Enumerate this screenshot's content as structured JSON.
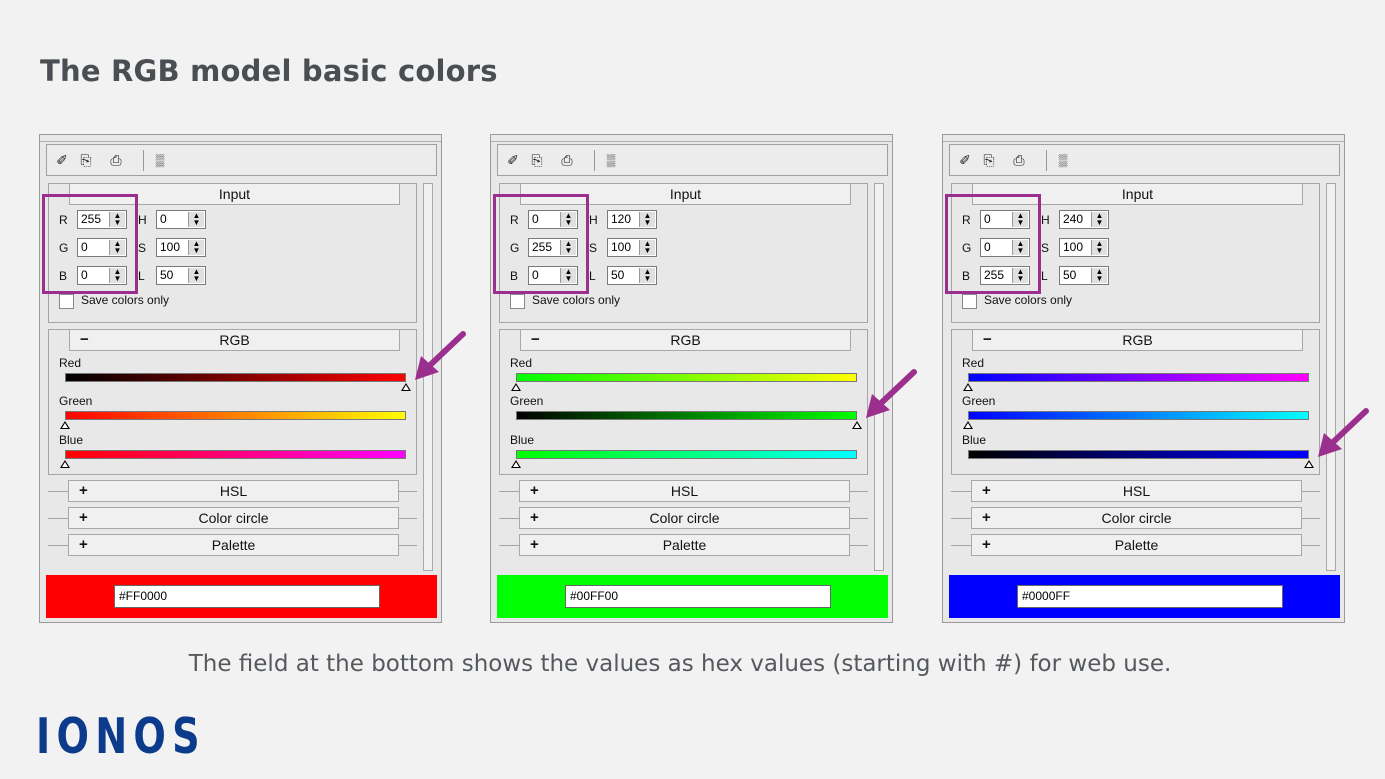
{
  "page": {
    "title": "The RGB model basic colors",
    "caption": "The field at the bottom shows the values as hex values (starting with #) for web use.",
    "logo": "IONOS",
    "highlight_color": "#9b2f8e",
    "logo_color": "#0d3b8c"
  },
  "labels": {
    "input_header": "Input",
    "rgb_header": "RGB",
    "hsl_header": "HSL",
    "circle_header": "Color circle",
    "palette_header": "Palette",
    "save_colors": "Save colors only",
    "minus": "−",
    "plus": "+",
    "r": "R",
    "g": "G",
    "b": "B",
    "h": "H",
    "s": "S",
    "l": "L",
    "red": "Red",
    "green": "Green",
    "blue": "Blue"
  },
  "toolbar_icons": [
    "eyedropper-icon",
    "copy-icon",
    "paste-icon",
    "grid-icon"
  ],
  "panels": [
    {
      "name": "red",
      "r": "255",
      "g": "0",
      "b": "0",
      "h": "0",
      "s": "100",
      "l": "50",
      "hex": "#FF0000",
      "swatch": "#ff0000",
      "slider_positions": {
        "red": 1.0,
        "green": 0.0,
        "blue": 0.0
      },
      "gradients": {
        "red": [
          "#000000",
          "#ff0000"
        ],
        "green": [
          "#ff0000",
          "#ffff00"
        ],
        "blue": [
          "#ff0000",
          "#ff00ff"
        ]
      },
      "arrow_on": "red"
    },
    {
      "name": "green",
      "r": "0",
      "g": "255",
      "b": "0",
      "h": "120",
      "s": "100",
      "l": "50",
      "hex": "#00FF00",
      "swatch": "#00ff00",
      "slider_positions": {
        "red": 0.0,
        "green": 1.0,
        "blue": 0.0
      },
      "gradients": {
        "red": [
          "#00ff00",
          "#ffff00"
        ],
        "green": [
          "#000000",
          "#00ff00"
        ],
        "blue": [
          "#00ff00",
          "#00ffff"
        ]
      },
      "arrow_on": "green"
    },
    {
      "name": "blue",
      "r": "0",
      "g": "0",
      "b": "255",
      "h": "240",
      "s": "100",
      "l": "50",
      "hex": "#0000FF",
      "swatch": "#0000ff",
      "slider_positions": {
        "red": 0.0,
        "green": 0.0,
        "blue": 1.0
      },
      "gradients": {
        "red": [
          "#0000ff",
          "#ff00ff"
        ],
        "green": [
          "#0000ff",
          "#00ffff"
        ],
        "blue": [
          "#000000",
          "#0000ff"
        ]
      },
      "arrow_on": "blue"
    }
  ]
}
